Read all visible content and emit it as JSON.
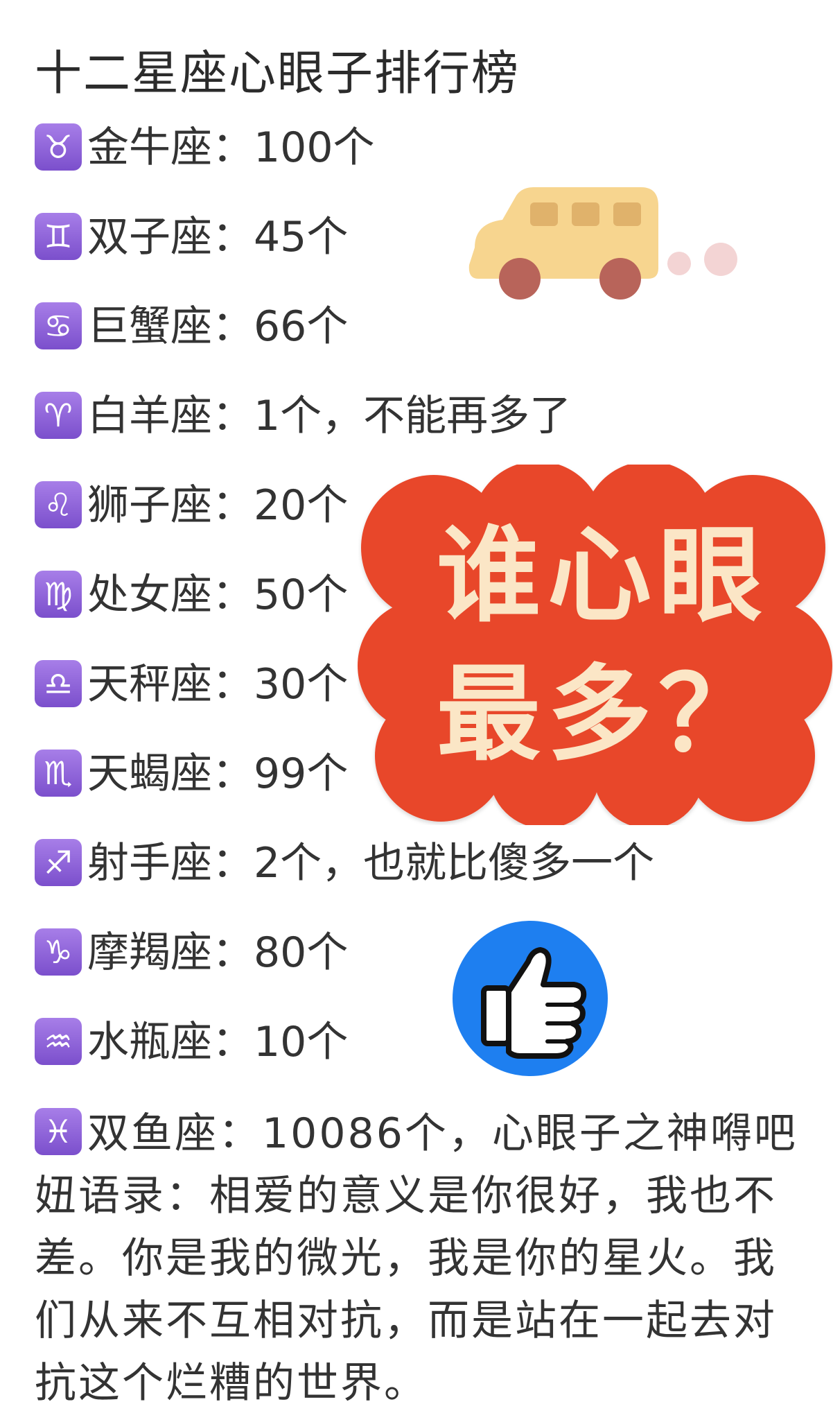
{
  "title": "十二星座心眼子排行榜",
  "items": [
    {
      "symbol": "♉",
      "text": "金牛座：100个"
    },
    {
      "symbol": "♊",
      "text": "双子座：45个"
    },
    {
      "symbol": "♋",
      "text": "巨蟹座：66个"
    },
    {
      "symbol": "♈",
      "text": "白羊座：1个，不能再多了"
    },
    {
      "symbol": "♌",
      "text": "狮子座：20个"
    },
    {
      "symbol": "♍",
      "text": "处女座：50个"
    },
    {
      "symbol": "♎",
      "text": "天秤座：30个"
    },
    {
      "symbol": "♏",
      "text": "天蝎座：99个"
    },
    {
      "symbol": "♐",
      "text": "射手座：2个，也就比傻多一个"
    },
    {
      "symbol": "♑",
      "text": "摩羯座：80个"
    },
    {
      "symbol": "♒",
      "text": "水瓶座：10个"
    }
  ],
  "final": {
    "symbol": "♓",
    "text": "双鱼座：10086个，心眼子之神嘚吧妞语录：相爱的意义是你很好，我也不差。你是我的微光，我是你的星火。我们从来不互相对抗，而是站在一起去对抗这个烂糟的世界。"
  },
  "sticker": {
    "line1": "谁心眼",
    "line2": "最多？",
    "bubble_color": "#e8472a",
    "text_color": "#fbe6c6"
  },
  "colors": {
    "badge": "#8e5fd8",
    "bus": "#f7d58f",
    "thumb_circle": "#1e7ff0"
  }
}
